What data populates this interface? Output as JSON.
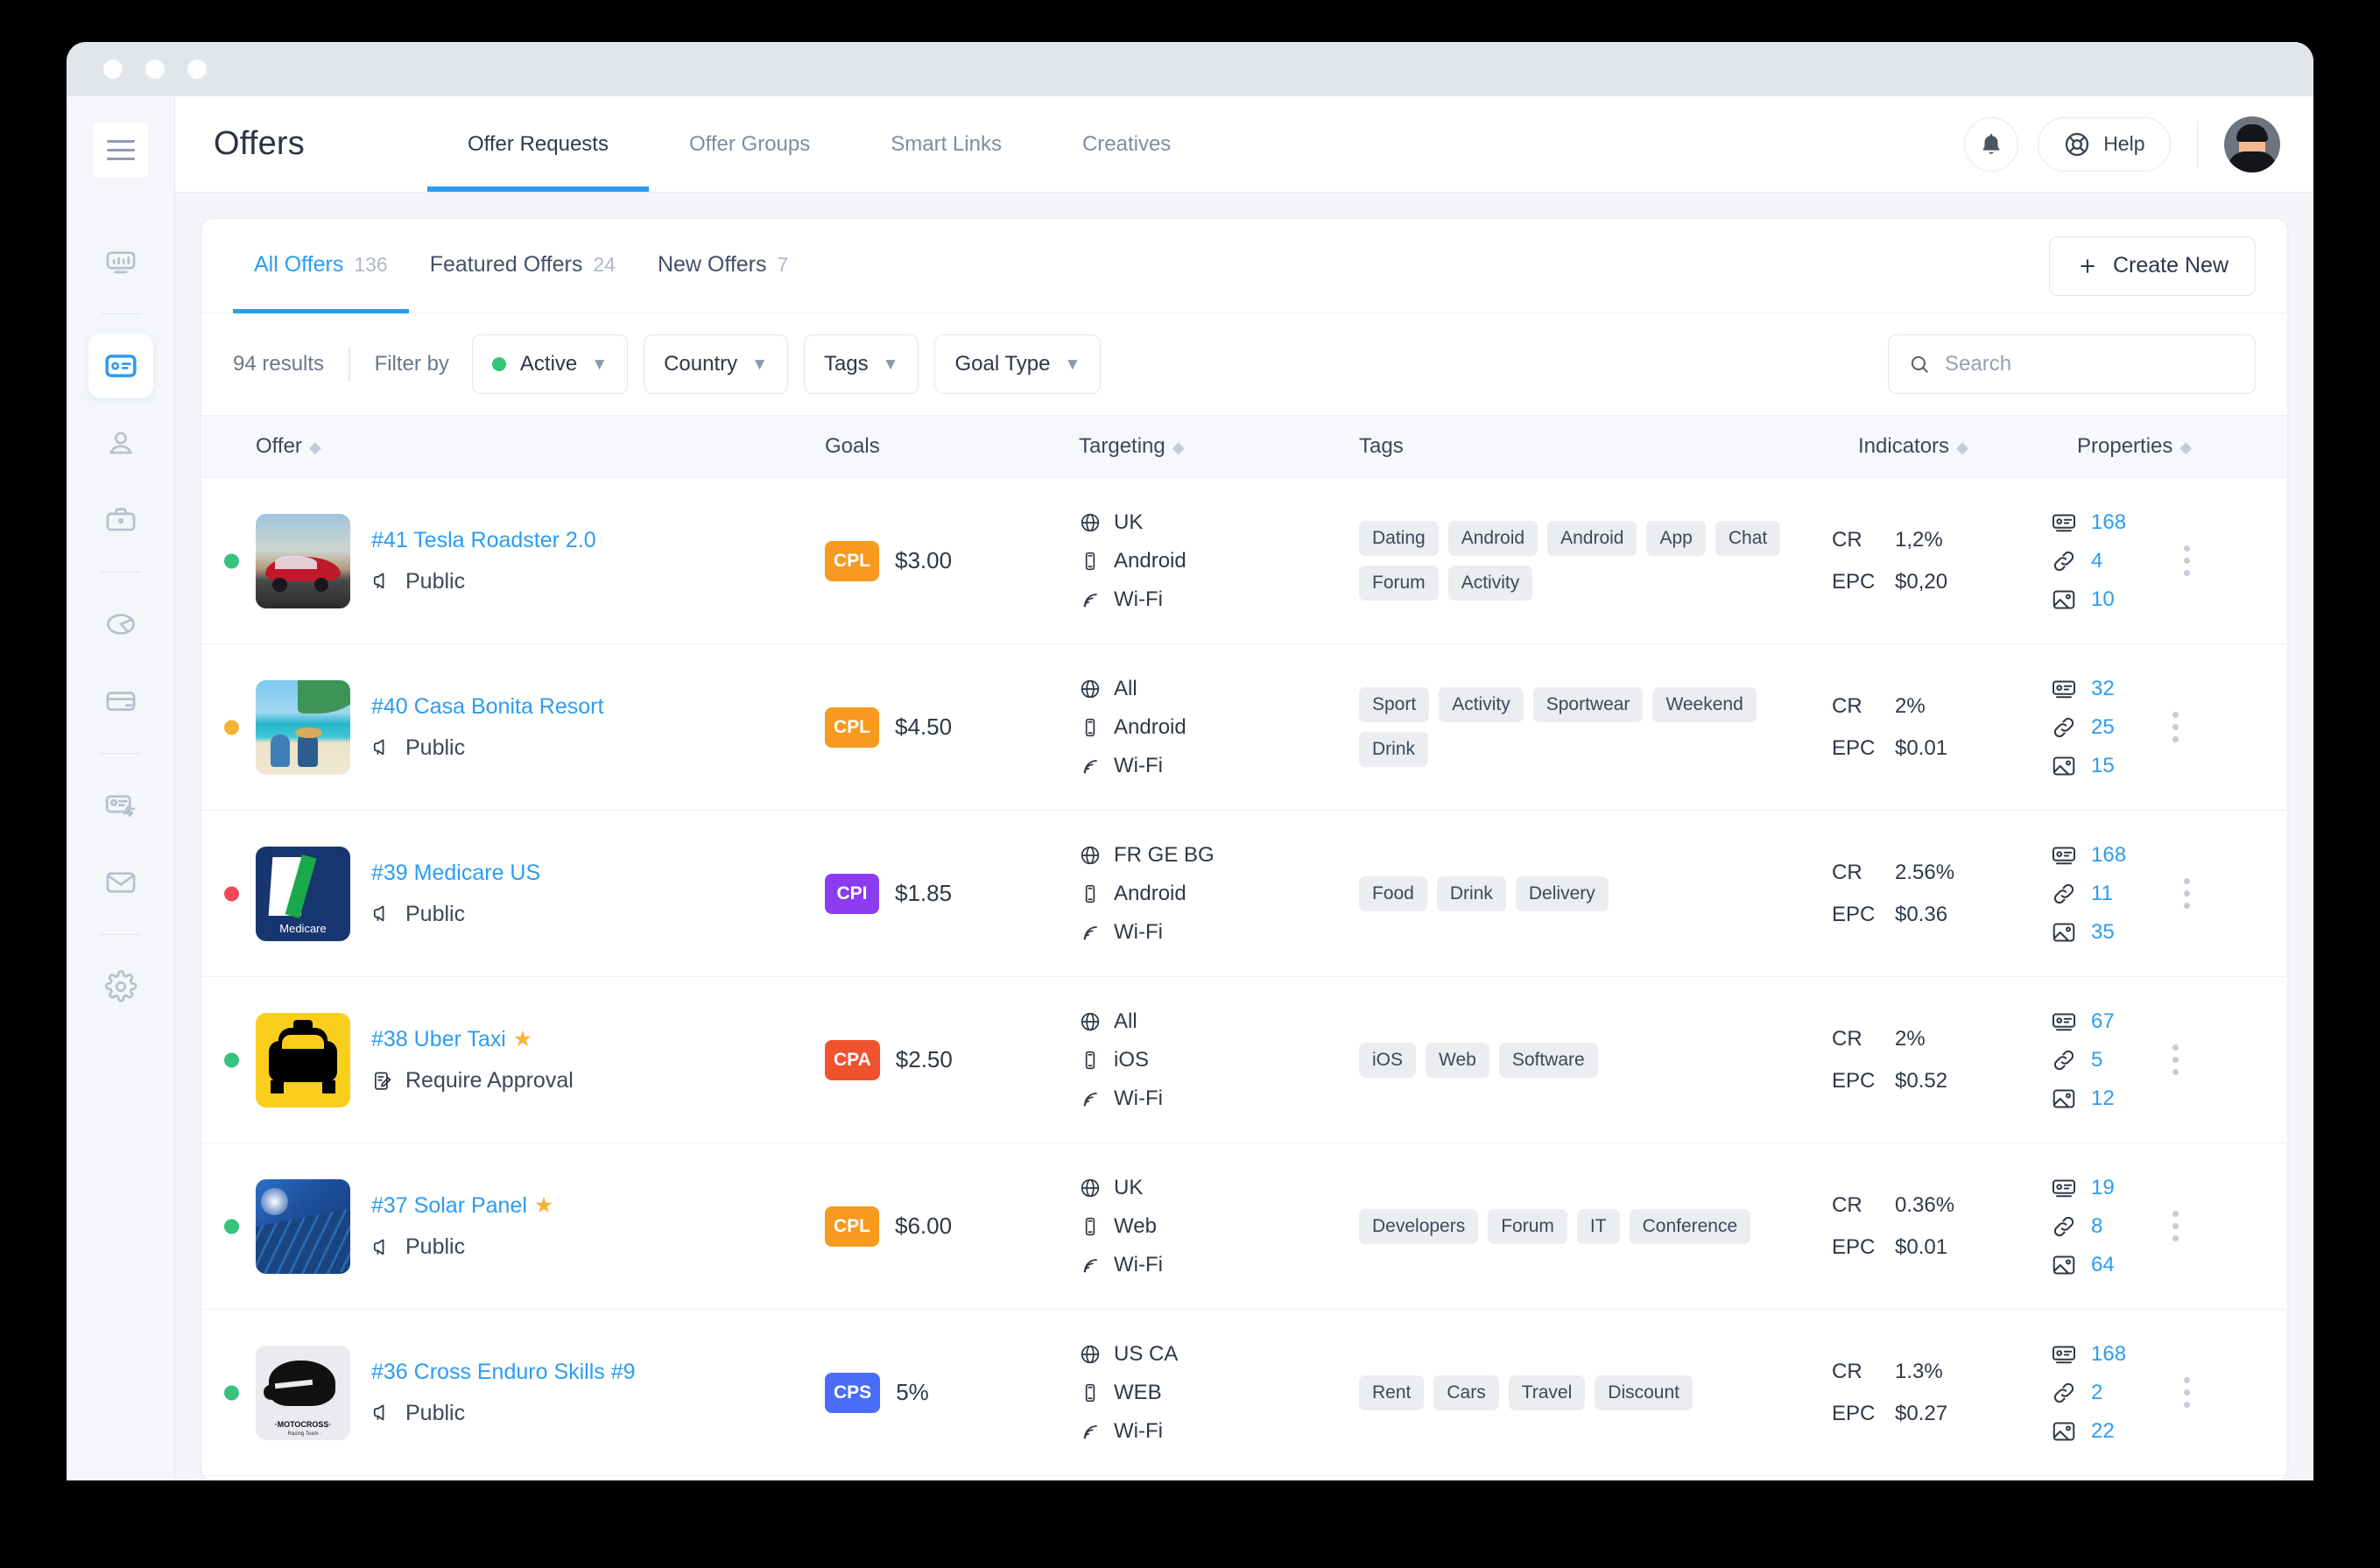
{
  "window": {
    "dots": [
      "",
      "",
      ""
    ]
  },
  "sidebar": {
    "menu_icon": "hamburger-menu-icon",
    "items": [
      {
        "name": "dashboard",
        "icon": "dashboard-icon",
        "active": false,
        "sep_after": true
      },
      {
        "name": "offers",
        "icon": "offers-card-icon",
        "active": true,
        "sep_after": false
      },
      {
        "name": "affiliates",
        "icon": "user-icon",
        "active": false,
        "sep_after": false
      },
      {
        "name": "advertisers",
        "icon": "briefcase-icon",
        "active": false,
        "sep_after": true
      },
      {
        "name": "reports",
        "icon": "pie-chart-icon",
        "active": false,
        "sep_after": false
      },
      {
        "name": "billing",
        "icon": "credit-card-icon",
        "active": false,
        "sep_after": true
      },
      {
        "name": "conversions",
        "icon": "card-sync-icon",
        "active": false,
        "sep_after": false
      },
      {
        "name": "messages",
        "icon": "mail-icon",
        "active": false,
        "sep_after": true
      },
      {
        "name": "settings",
        "icon": "gear-icon",
        "active": false,
        "sep_after": false
      }
    ]
  },
  "header": {
    "title": "Offers",
    "nav": [
      {
        "label": "Offer Requests",
        "active": true
      },
      {
        "label": "Offer Groups",
        "active": false
      },
      {
        "label": "Smart Links",
        "active": false
      },
      {
        "label": "Creatives",
        "active": false
      }
    ],
    "bell_icon": "bell-icon",
    "help_label": "Help",
    "help_icon": "lifebuoy-icon",
    "avatar": "user-avatar"
  },
  "tabs": [
    {
      "label": "All Offers",
      "count": "136",
      "active": true
    },
    {
      "label": "Featured Offers",
      "count": "24",
      "active": false
    },
    {
      "label": "New Offers",
      "count": "7",
      "active": false
    }
  ],
  "create_new": {
    "label": "Create New",
    "icon": "plus-icon"
  },
  "filters": {
    "results": "94 results",
    "filter_by": "Filter by",
    "dropdowns": [
      {
        "label": "Active",
        "dot": "#35c37d"
      },
      {
        "label": "Country",
        "dot": null
      },
      {
        "label": "Tags",
        "dot": null
      },
      {
        "label": "Goal Type",
        "dot": null
      }
    ]
  },
  "search": {
    "placeholder": "Search",
    "value": "",
    "icon": "search-icon"
  },
  "table": {
    "columns": [
      {
        "label": "Offer",
        "sortable": true
      },
      {
        "label": "Goals",
        "sortable": false
      },
      {
        "label": "Targeting",
        "sortable": true
      },
      {
        "label": "Tags",
        "sortable": false
      },
      {
        "label": "Indicators",
        "sortable": true
      },
      {
        "label": "Properties",
        "sortable": true
      }
    ],
    "rows": [
      {
        "status_color": "#35c37d",
        "thumb": "tesla-roadster-photo",
        "name": "#41 Tesla Roadster 2.0",
        "featured": false,
        "access": "Public",
        "access_icon": "megaphone-icon",
        "goal_type": "CPL",
        "goal_color": "#f79a1f",
        "goal_value": "$3.00",
        "targeting": [
          {
            "icon": "globe-icon",
            "label": "UK"
          },
          {
            "icon": "mobile-icon",
            "label": "Android"
          },
          {
            "icon": "wifi-icon",
            "label": "Wi-Fi"
          }
        ],
        "tags": [
          "Dating",
          "Android",
          "Android",
          "App",
          "Chat",
          "Forum",
          "Activity"
        ],
        "indicators": [
          {
            "key": "CR",
            "value": "1,2%"
          },
          {
            "key": "EPC",
            "value": "$0,20"
          }
        ],
        "properties": [
          {
            "icon": "landing-page-icon",
            "value": "168"
          },
          {
            "icon": "link-icon",
            "value": "4"
          },
          {
            "icon": "image-icon",
            "value": "10"
          }
        ]
      },
      {
        "status_color": "#f5b335",
        "thumb": "beach-resort-photo",
        "name": "#40 Casa Bonita Resort",
        "featured": false,
        "access": "Public",
        "access_icon": "megaphone-icon",
        "goal_type": "CPL",
        "goal_color": "#f79a1f",
        "goal_value": "$4.50",
        "targeting": [
          {
            "icon": "globe-icon",
            "label": "All"
          },
          {
            "icon": "mobile-icon",
            "label": "Android"
          },
          {
            "icon": "wifi-icon",
            "label": "Wi-Fi"
          }
        ],
        "tags": [
          "Sport",
          "Activity",
          "Sportwear",
          "Weekend",
          "Drink"
        ],
        "indicators": [
          {
            "key": "CR",
            "value": "2%"
          },
          {
            "key": "EPC",
            "value": "$0.01"
          }
        ],
        "properties": [
          {
            "icon": "landing-page-icon",
            "value": "32"
          },
          {
            "icon": "link-icon",
            "value": "25"
          },
          {
            "icon": "image-icon",
            "value": "15"
          }
        ]
      },
      {
        "status_color": "#f04a5a",
        "thumb": "medicare-logo",
        "name": "#39 Medicare US",
        "featured": false,
        "access": "Public",
        "access_icon": "megaphone-icon",
        "goal_type": "CPI",
        "goal_color": "#8b3cf0",
        "goal_value": "$1.85",
        "targeting": [
          {
            "icon": "globe-icon",
            "label": "FR GE BG"
          },
          {
            "icon": "mobile-icon",
            "label": "Android"
          },
          {
            "icon": "wifi-icon",
            "label": "Wi-Fi"
          }
        ],
        "tags": [
          "Food",
          "Drink",
          "Delivery"
        ],
        "indicators": [
          {
            "key": "CR",
            "value": "2.56%"
          },
          {
            "key": "EPC",
            "value": "$0.36"
          }
        ],
        "properties": [
          {
            "icon": "landing-page-icon",
            "value": "168"
          },
          {
            "icon": "link-icon",
            "value": "11"
          },
          {
            "icon": "image-icon",
            "value": "35"
          }
        ]
      },
      {
        "status_color": "#35c37d",
        "thumb": "taxi-logo",
        "name": "#38 Uber Taxi",
        "featured": true,
        "access": "Require Approval",
        "access_icon": "approval-icon",
        "goal_type": "CPA",
        "goal_color": "#f0522f",
        "goal_value": "$2.50",
        "targeting": [
          {
            "icon": "globe-icon",
            "label": "All"
          },
          {
            "icon": "mobile-icon",
            "label": "iOS"
          },
          {
            "icon": "wifi-icon",
            "label": "Wi-Fi"
          }
        ],
        "tags": [
          "iOS",
          "Web",
          "Software"
        ],
        "indicators": [
          {
            "key": "CR",
            "value": "2%"
          },
          {
            "key": "EPC",
            "value": "$0.52"
          }
        ],
        "properties": [
          {
            "icon": "landing-page-icon",
            "value": "67"
          },
          {
            "icon": "link-icon",
            "value": "5"
          },
          {
            "icon": "image-icon",
            "value": "12"
          }
        ]
      },
      {
        "status_color": "#35c37d",
        "thumb": "solar-panel-photo",
        "name": "#37 Solar Panel",
        "featured": true,
        "access": "Public",
        "access_icon": "megaphone-icon",
        "goal_type": "CPL",
        "goal_color": "#f79a1f",
        "goal_value": "$6.00",
        "targeting": [
          {
            "icon": "globe-icon",
            "label": "UK"
          },
          {
            "icon": "mobile-icon",
            "label": "Web"
          },
          {
            "icon": "wifi-icon",
            "label": "Wi-Fi"
          }
        ],
        "tags": [
          "Developers",
          "Forum",
          "IT",
          "Conference"
        ],
        "indicators": [
          {
            "key": "CR",
            "value": "0.36%"
          },
          {
            "key": "EPC",
            "value": "$0.01"
          }
        ],
        "properties": [
          {
            "icon": "landing-page-icon",
            "value": "19"
          },
          {
            "icon": "link-icon",
            "value": "8"
          },
          {
            "icon": "image-icon",
            "value": "64"
          }
        ]
      },
      {
        "status_color": "#35c37d",
        "thumb": "motocross-logo",
        "name": "#36 Cross Enduro Skills #9",
        "featured": false,
        "access": "Public",
        "access_icon": "megaphone-icon",
        "goal_type": "CPS",
        "goal_color": "#4a6cf7",
        "goal_value": "5%",
        "targeting": [
          {
            "icon": "globe-icon",
            "label": "US CA"
          },
          {
            "icon": "mobile-icon",
            "label": "WEB"
          },
          {
            "icon": "wifi-icon",
            "label": "Wi-Fi"
          }
        ],
        "tags": [
          "Rent",
          "Cars",
          "Travel",
          "Discount"
        ],
        "indicators": [
          {
            "key": "CR",
            "value": "1.3%"
          },
          {
            "key": "EPC",
            "value": "$0.27"
          }
        ],
        "properties": [
          {
            "icon": "landing-page-icon",
            "value": "168"
          },
          {
            "icon": "link-icon",
            "value": "2"
          },
          {
            "icon": "image-icon",
            "value": "22"
          }
        ]
      }
    ]
  }
}
